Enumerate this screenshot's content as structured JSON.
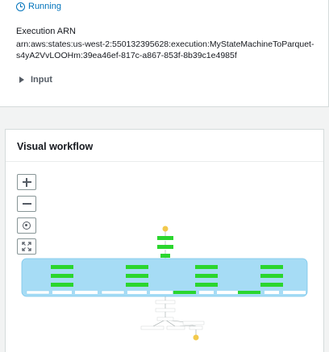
{
  "execution": {
    "status": "Running",
    "arn_label": "Execution ARN",
    "arn_value": "arn:aws:states:us-west-2:550132395628:execution:MyStateMachineToParquet-s4yA2VvLOOHm:39ea46ef-817c-a867-853f-8b39c1e4985f",
    "input_label": "Input"
  },
  "workflow": {
    "title": "Visual workflow"
  },
  "colors": {
    "running_blue": "#0073bb",
    "succeeded_green": "#2bd62e",
    "in_progress_blue": "#a6dcf5",
    "start_end_yellow": "#f2c94c",
    "parallel_bg": "#a6dcf5"
  },
  "icons": [
    "status-info-icon",
    "caret-right-icon",
    "zoom-in-icon",
    "zoom-out-icon",
    "center-icon",
    "fit-to-screen-icon"
  ]
}
